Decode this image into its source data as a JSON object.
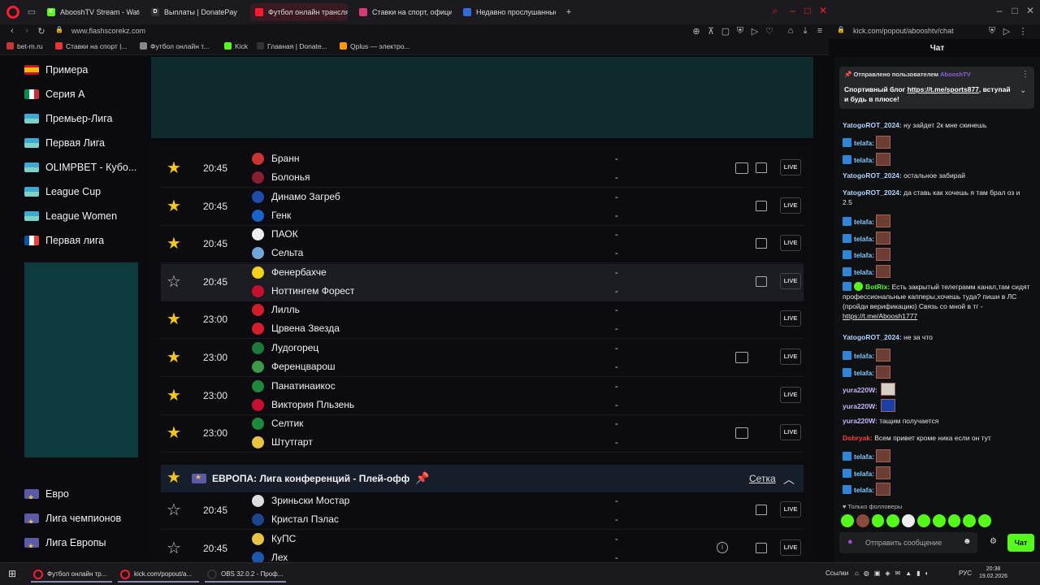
{
  "tabs": [
    {
      "label": "AbooshTV Stream - Watch",
      "fav": "K",
      "color": "#53fc18"
    },
    {
      "label": "Выплаты | DonatePay",
      "fav": "D",
      "color": "#333"
    },
    {
      "label": "Футбол онлайн трансляц",
      "fav": "",
      "color": "#ff1b2d"
    },
    {
      "label": "Ставки на спорт, официа",
      "fav": "",
      "color": "#d93a7a"
    },
    {
      "label": "Недавно прослушанные",
      "fav": "",
      "color": "#2f6ed8"
    }
  ],
  "address": {
    "left": "www.flashscorekz.com",
    "right": "kick.com/popout/abooshtv/chat"
  },
  "bookmarks": [
    {
      "label": "bet-m.ru",
      "color": "#c33"
    },
    {
      "label": "Ставки на спорт |...",
      "color": "#e33"
    },
    {
      "label": "Футбол онлайн т...",
      "color": "#888"
    },
    {
      "label": "Kick",
      "color": "#53fc18"
    },
    {
      "label": "Главная | Donate...",
      "color": "#333"
    },
    {
      "label": "Qplus — электро...",
      "color": "#f90"
    }
  ],
  "sidebar": {
    "top_items": [
      {
        "label": "Примера",
        "flag": "es"
      },
      {
        "label": "Серия A",
        "flag": "it"
      },
      {
        "label": "Премьер-Лига",
        "flag": "ua"
      },
      {
        "label": "Первая Лига",
        "flag": "ua"
      },
      {
        "label": "OLIMPBET - Кубо...",
        "flag": "ua"
      },
      {
        "label": "League Cup",
        "flag": "ua"
      },
      {
        "label": "League Women",
        "flag": "ua"
      },
      {
        "label": "Первая лига",
        "flag": "fr"
      }
    ],
    "bottom_items": [
      {
        "label": "Евро",
        "flag": "eu"
      },
      {
        "label": "Лига чемпионов",
        "flag": "eu"
      },
      {
        "label": "Лига Европы",
        "flag": "eu"
      }
    ]
  },
  "matches": [
    {
      "time": "20:45",
      "home": "Бранн",
      "away": "Болонья",
      "home_score": "-",
      "away_score": "-",
      "starred": true,
      "tv": true,
      "shirt": true,
      "info": false,
      "hc": "#c33",
      "ac": "#8b1e2f"
    },
    {
      "time": "20:45",
      "home": "Динамо Загреб",
      "away": "Генк",
      "home_score": "-",
      "away_score": "-",
      "starred": true,
      "tv": false,
      "shirt": true,
      "info": false,
      "hc": "#1f4ca8",
      "ac": "#1a63c8"
    },
    {
      "time": "20:45",
      "home": "ПАОК",
      "away": "Сельта",
      "home_score": "-",
      "away_score": "-",
      "starred": true,
      "tv": false,
      "shirt": true,
      "info": false,
      "hc": "#eee",
      "ac": "#6fa7d8"
    },
    {
      "time": "20:45",
      "home": "Фенербахче",
      "away": "Ноттингем Форест",
      "home_score": "-",
      "away_score": "-",
      "starred": false,
      "tv": false,
      "shirt": true,
      "info": false,
      "hc": "#f3d21a",
      "ac": "#c8102e"
    },
    {
      "time": "23:00",
      "home": "Лилль",
      "away": "Црвена Звезда",
      "home_score": "-",
      "away_score": "-",
      "starred": true,
      "tv": false,
      "shirt": false,
      "info": false,
      "hc": "#d21e2b",
      "ac": "#d21e2b"
    },
    {
      "time": "23:00",
      "home": "Лудогорец",
      "away": "Ференцварош",
      "home_score": "-",
      "away_score": "-",
      "starred": true,
      "tv": true,
      "shirt": false,
      "info": false,
      "hc": "#1c7a3c",
      "ac": "#3a9a4a"
    },
    {
      "time": "23:00",
      "home": "Панатинаикос",
      "away": "Виктория Пльзень",
      "home_score": "-",
      "away_score": "-",
      "starred": true,
      "tv": false,
      "shirt": false,
      "info": false,
      "hc": "#1c8a3c",
      "ac": "#c8102e"
    },
    {
      "time": "23:00",
      "home": "Селтик",
      "away": "Штутгарт",
      "home_score": "-",
      "away_score": "-",
      "starred": true,
      "tv": true,
      "shirt": false,
      "info": false,
      "hc": "#1c8a3c",
      "ac": "#e8c440"
    }
  ],
  "league_header": {
    "title": "ЕВРОПА: Лига конференций - Плей-офф",
    "link": "Сетка"
  },
  "matches2": [
    {
      "time": "20:45",
      "home": "Зриньски Мостар",
      "away": "Кристал Пэлас",
      "home_score": "-",
      "away_score": "-",
      "starred": false,
      "tv": false,
      "shirt": true,
      "info": false,
      "hc": "#ddd",
      "ac": "#1b458f"
    },
    {
      "time": "20:45",
      "home": "КуПС",
      "away": "Лех",
      "home_score": "-",
      "away_score": "-",
      "starred": false,
      "tv": false,
      "shirt": true,
      "info": true,
      "hc": "#e8c440",
      "ac": "#1b58b0"
    }
  ],
  "live_label": "LIVE",
  "chat": {
    "title": "Чат",
    "pinned_by": "Отправлено пользователем",
    "pinned_user": "AbooshTV",
    "pinned_text": "Спортивный блог",
    "pinned_link": "https://t.me/sports877",
    "pinned_text2": ", вступай и будь в плюсе!",
    "msg1_user": "YatogoROT_2024:",
    "msg1_text": "ну зайдет 2к мне скинешь",
    "emote_user": "telafa:",
    "msg2_user": "YatogoROT_2024:",
    "msg2_text": "остальное забирай",
    "msg3_user": "YatogoROT_2024:",
    "msg3_text": "да ставь как хочешь я там брал оз и 2.5",
    "bot_user": "BotRix:",
    "bot_text": "Есть закрытый телеграмм канал,там сидят профессиональные капперы,хочешь туда? пиши в ЛС (пройди верификацию) Связь со мной в тг -",
    "bot_link": "https://t.me/Aboosh1777",
    "msg4_user": "YatogoROT_2024:",
    "msg4_text": "не за что",
    "yura_user": "yura220W:",
    "msg5_user": "yura220W:",
    "msg5_text": "тащим получается",
    "dob_user": "Dobryak:",
    "dob_text": "Всем привет кроме ника если он тут",
    "followers_only": "Только фолловеры",
    "input_placeholder": "Отправить сообщение",
    "send_label": "Чат"
  },
  "taskbar": {
    "tasks": [
      "Футбол онлайн тр...",
      "kick.com/popout/a...",
      "OBS 32.0.2 - Проф..."
    ],
    "links": "Ссылки",
    "lang": "РУС",
    "time": "20:38",
    "date": "19.02.2026"
  }
}
